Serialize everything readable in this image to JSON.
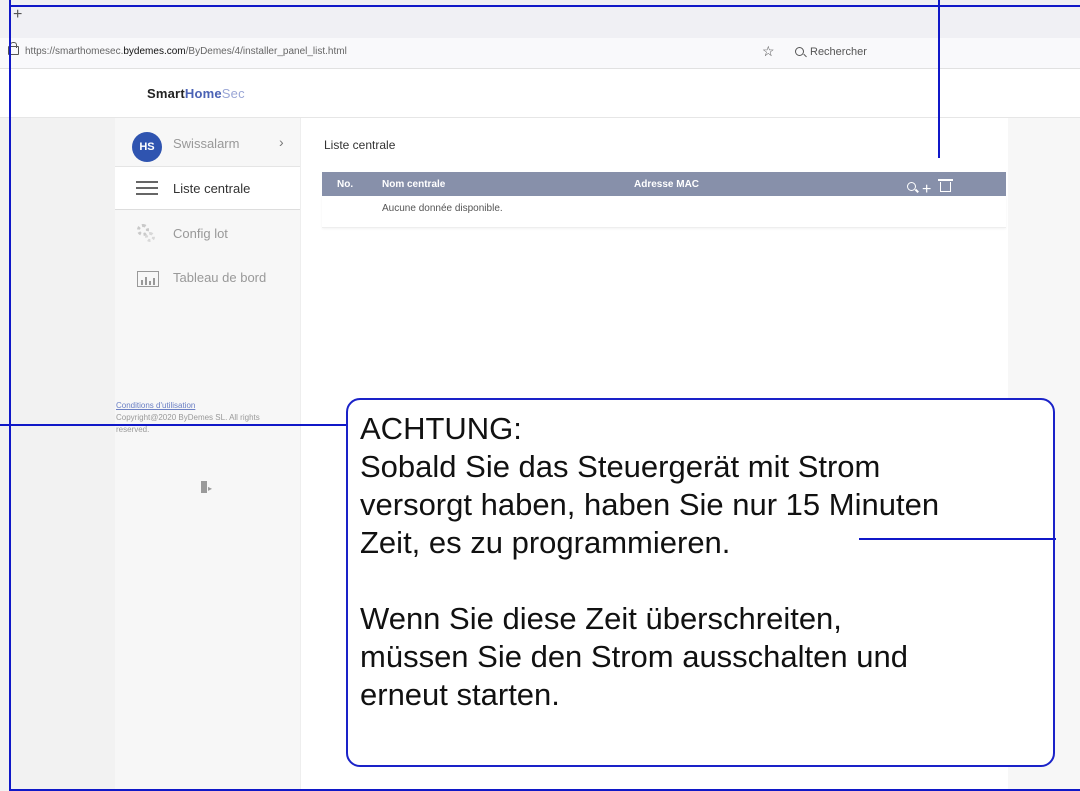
{
  "browser": {
    "new_tab": "+",
    "url_prefix": "https://smarthomesec.",
    "url_domain": "bydemes.com",
    "url_path": "/ByDemes/4/installer_panel_list.html",
    "search_placeholder": "Rechercher"
  },
  "header": {
    "logo_part1": "Smart",
    "logo_part2": "Home",
    "logo_part3": "Sec"
  },
  "sidebar": {
    "org": {
      "initials": "HS",
      "name": "Swissalarm"
    },
    "items": [
      {
        "label": "Liste centrale"
      },
      {
        "label": "Config lot"
      },
      {
        "label": "Tableau de bord"
      }
    ],
    "terms_link": "Conditions d'utilisation",
    "copyright": "Copyright@2020 ByDemes SL. All rights reserved."
  },
  "main": {
    "title": "Liste centrale",
    "table": {
      "columns": [
        "No.",
        "Nom centrale",
        "Adresse MAC"
      ],
      "empty_message": "Aucune donnée disponible."
    }
  },
  "annotation": {
    "lines": [
      "ACHTUNG:",
      "Sobald Sie das Steuergerät mit Strom",
      "versorgt haben, haben Sie nur 15 Minuten",
      "Zeit, es zu programmieren.",
      "",
      "Wenn Sie diese Zeit überschreiten,",
      "müssen Sie den Strom ausschalten und",
      "erneut starten."
    ]
  },
  "colors": {
    "accent": "#2f54b0",
    "table_header": "#8790aa",
    "annotation": "#1018c8"
  }
}
